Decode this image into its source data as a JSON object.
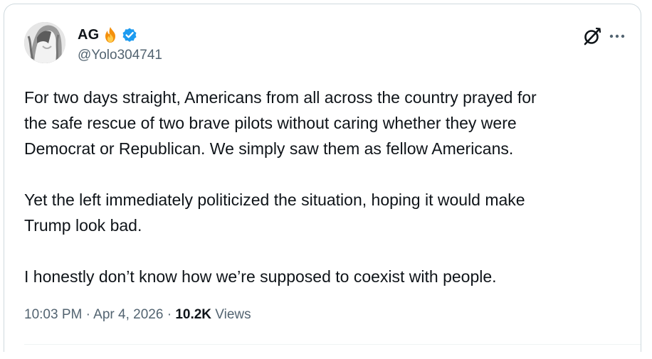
{
  "author": {
    "display_name": "AG",
    "handle": "@Yolo304741",
    "badge_emoji": "fire-icon",
    "verified": true,
    "verified_color": "#1d9bf0"
  },
  "tweet": {
    "paragraphs": [
      "For two days straight, Americans from all across the country prayed for\nthe safe rescue of two brave pilots without caring whether they were\nDemocrat or Republican. We simply saw them as fellow Americans.",
      "Yet the left immediately politicized the situation, hoping it would make\nTrump look bad.",
      "I honestly don’t know how we’re supposed to coexist with people."
    ]
  },
  "meta": {
    "time": "10:03 PM",
    "date": "Apr 4, 2026",
    "separator": "·",
    "views_count": "10.2K",
    "views_label": "Views"
  },
  "colors": {
    "text_primary": "#0f1419",
    "text_secondary": "#536471",
    "border": "#cfd9de"
  }
}
